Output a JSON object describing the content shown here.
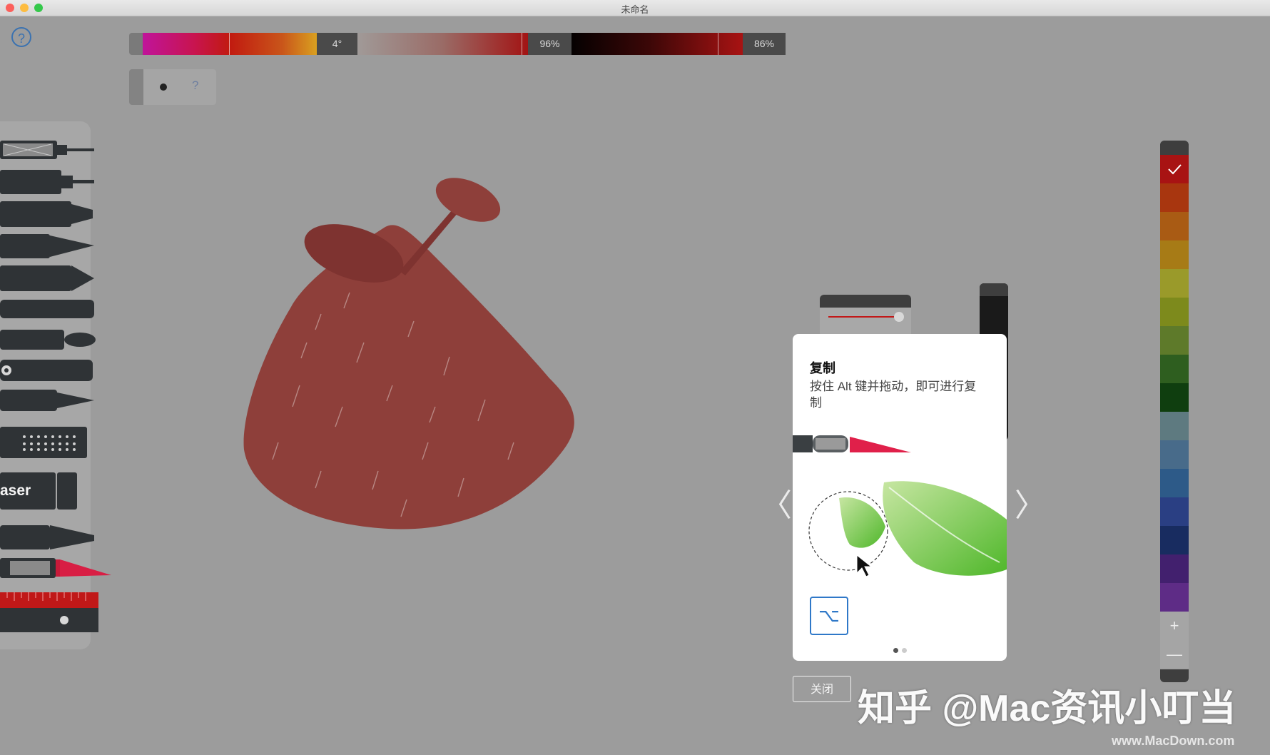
{
  "window": {
    "title": "未命名"
  },
  "toolbar": {
    "help_icon": "question-circle-icon",
    "hue_value": "4°",
    "saturation_value": "96%",
    "brightness_value": "86%",
    "brush_size_help": "?"
  },
  "tools": [
    {
      "name": "technical-pen",
      "icon": "technical-pen-icon"
    },
    {
      "name": "pen",
      "icon": "pen-icon"
    },
    {
      "name": "marker",
      "icon": "marker-icon"
    },
    {
      "name": "pencil",
      "icon": "pencil-icon"
    },
    {
      "name": "chisel-marker",
      "icon": "chisel-marker-icon"
    },
    {
      "name": "wide-brush",
      "icon": "wide-brush-icon"
    },
    {
      "name": "round-brush",
      "icon": "round-brush-icon"
    },
    {
      "name": "airbrush",
      "icon": "airbrush-icon"
    },
    {
      "name": "fountain-pen",
      "icon": "fountain-pen-icon"
    },
    {
      "name": "texture-brush",
      "icon": "texture-brush-icon"
    },
    {
      "name": "eraser",
      "icon": "eraser-icon",
      "label": "aser"
    },
    {
      "name": "fan-brush",
      "icon": "fan-brush-icon"
    },
    {
      "name": "selection-knife",
      "icon": "selection-knife-icon"
    },
    {
      "name": "ruler",
      "icon": "ruler-icon"
    }
  ],
  "swatches": {
    "colors": [
      "#a81313",
      "#a8360f",
      "#a95b14",
      "#a77b16",
      "#9a9a2a",
      "#7d8a1c",
      "#5e7a2a",
      "#2e5e1f",
      "#0f3e0f",
      "#5e7a80",
      "#486b8a",
      "#2d5a88",
      "#2a3f83",
      "#182c60",
      "#42206e",
      "#5e2c86"
    ],
    "selected_icon": "checkmark-icon",
    "add_icon": "plus-icon",
    "remove_icon": "minus-icon",
    "add_label": "+",
    "remove_label": "—"
  },
  "tooltip": {
    "title": "复制",
    "body": "按住 Alt 键并拖动，即可进行复制",
    "key_icon": "option-key-icon",
    "key_glyph": "⌥",
    "pages": 2,
    "current_page": 1
  },
  "nav": {
    "prev_icon": "chevron-left-icon",
    "next_icon": "chevron-right-icon",
    "prev_glyph": "〈",
    "next_glyph": "〉"
  },
  "buttons": {
    "close_label": "关闭"
  },
  "watermark": {
    "text": "知乎 @Mac资讯小叮当",
    "site": "www.MacDown.com"
  },
  "colors": {
    "canvas_bg": "#9c9c9c",
    "drawing_fill": "#8e3f3a",
    "accent_blue": "#2f78c8",
    "selection_red": "#e0204a"
  }
}
